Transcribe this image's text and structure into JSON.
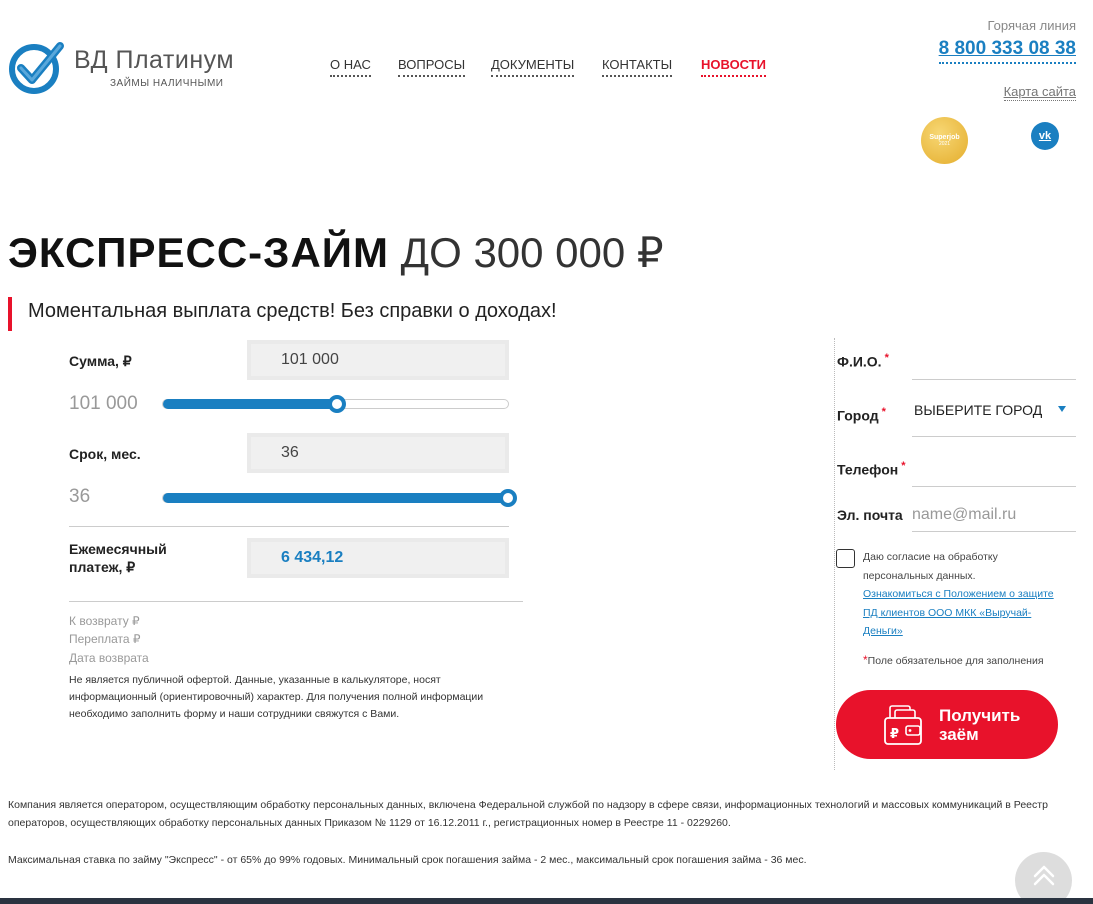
{
  "brand": {
    "name": "ВД Платинум",
    "tagline": "ЗАЙМЫ НАЛИЧНЫМИ",
    "accent": "#1a7fc1",
    "red": "#e8122b"
  },
  "nav": {
    "items": [
      {
        "label": "О НАС",
        "active": false
      },
      {
        "label": "ВОПРОСЫ",
        "active": false
      },
      {
        "label": "ДОКУМЕНТЫ",
        "active": false
      },
      {
        "label": "КОНТАКТЫ",
        "active": false
      },
      {
        "label": "НОВОСТИ",
        "active": true
      }
    ]
  },
  "header": {
    "hotline_label": "Горячая линия",
    "hotline_phone": "8 800 333 08 38",
    "sitemap_link": "Карта сайта",
    "award_badge": {
      "line1": "Superjob",
      "line2": "2021"
    },
    "social": {
      "vk_label": "vk",
      "icon": "vk-icon"
    }
  },
  "hero": {
    "title_bold": "ЭКСПРЕСС-ЗАЙМ",
    "title_light": "ДО 300 000 ₽",
    "subtitle": "Моментальная выплата средств! Без справки о доходах!"
  },
  "calculator": {
    "amount": {
      "label": "Сумма, ₽",
      "value": "101 000",
      "slider_value": "101 000",
      "fill_fraction": 0.505
    },
    "term": {
      "label": "Срок, мес.",
      "value": "36",
      "slider_value": "36",
      "fill_fraction": 1.0
    },
    "monthly": {
      "label_line1": "Ежемесячный",
      "label_line2": "платеж, ₽",
      "value": "6 434,12"
    },
    "summary": {
      "to_return": "К возврату ₽",
      "overpayment": "Переплата ₽",
      "return_date": "Дата возврата"
    },
    "disclaimer": "Не является публичной офертой. Данные, указанные в калькуляторе, носят информационный (ориентировочный) характер. Для получения полной информации необходимо заполнить форму и наши сотрудники свяжутся с Вами."
  },
  "form": {
    "fio_label": "Ф.И.О.",
    "city_label": "Город",
    "city_value": "ВЫБЕРИТЕ ГОРОД",
    "phone_label": "Телефон",
    "email_label": "Эл. почта",
    "email_placeholder": "name@mail.ru",
    "required_mark": "*",
    "consent_text": "Даю согласие на обработку персональных данных.",
    "consent_link": "Ознакомиться с Положением о защите ПД клиентов ООО МКК «Выручай-Деньги»",
    "required_note": "Поле обязательное для заполнения",
    "submit_line1": "Получить",
    "submit_line2": "заём"
  },
  "footer": {
    "operator_text": "Компания является оператором, осуществляющим обработку персональных данных, включена Федеральной службой по надзору в сфере связи, информационных технологий и массовых коммуникаций в Реестр операторов, осуществляющих обработку персональных данных Приказом № 1129 от 16.12.2011 г., регистрационных номер в Реестре 11 - 0229260.",
    "rate_text": "Максимальная ставка по займу \"Экспресс\" - от 65% до 99% годовых. Минимальный срок погашения займа - 2 мес., максимальный срок погашения займа - 36 мес."
  }
}
